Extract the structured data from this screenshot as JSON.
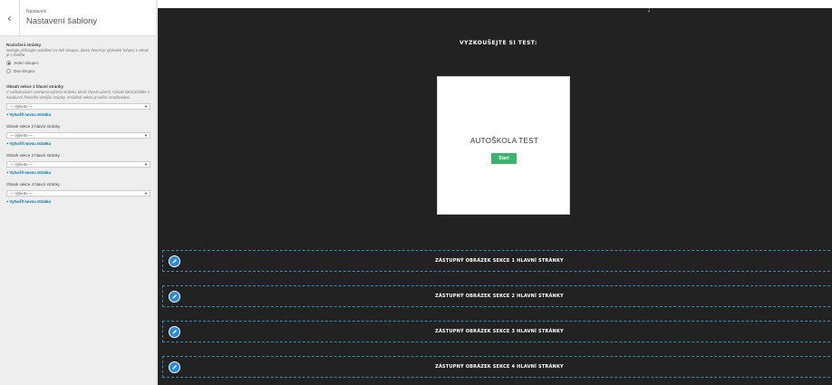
{
  "sidebar": {
    "back_icon": "chevron-left-icon",
    "subtitle": "Nastavení",
    "title": "Nastavení šablony",
    "layout": {
      "title": "Rozložení stránky",
      "desc": "Nebojte přílistujte rozložení se dvě sloupce, úkaní dvorní je výsledek Tohoto; v obrak je s lěváde.",
      "options": [
        {
          "label": "Jeden sloupec",
          "selected": true
        },
        {
          "label": "Dva sloupce",
          "selected": false
        }
      ]
    },
    "sections": [
      {
        "title": "Obsah sekce 1 hlavní stránky",
        "desc": "V rozbalovacím seznamu vyberte stránku, které chcete ulistnit. Obrakt lokál přidálte v nastavení hlavního vlstějšu stránky: zmíděné sekce je vidíce zmaštováno.",
        "select": "— Vyberte —",
        "link": "+ Vytvořit novou stránku"
      },
      {
        "title": "Obsah sekce 2 hlavní stránky",
        "desc": "",
        "select": "— Vyberte —",
        "link": "+ Vytvořit novou stránku"
      },
      {
        "title": "Obsah sekce 3 hlavní stránky",
        "desc": "",
        "select": "— Vyberte —",
        "link": "+ Vytvořit novou stránku"
      },
      {
        "title": "Obsah sekce 4 hlavní stránky",
        "desc": "",
        "select": "— Vyberte —",
        "link": "+ Vytvořit novou stránku"
      }
    ]
  },
  "preview": {
    "test_title": "VYZKOUŠEJTE SI TEST:",
    "quiz": {
      "name": "AUTOŠKOLA TEST",
      "start": "Start"
    },
    "placeholders": [
      "ZÁSTUPNÝ OBRÁZEK SEKCE 1 HLAVNÍ STRÁNKY",
      "ZÁSTUPNÝ OBRÁZEK SEKCE 2 HLAVNÍ STRÁNKY",
      "ZÁSTUPNÝ OBRÁZEK SEKCE 3 HLAVNÍ STRÁNKY",
      "ZÁSTUPNÝ OBRÁZEK SEKCE 4 HLAVNÍ STRÁNKY"
    ],
    "edit_icon": "pencil-icon"
  },
  "colors": {
    "preview_bg": "#222222",
    "accent": "#3cb371",
    "link": "#0073aa",
    "edit": "#2a8ad8"
  }
}
